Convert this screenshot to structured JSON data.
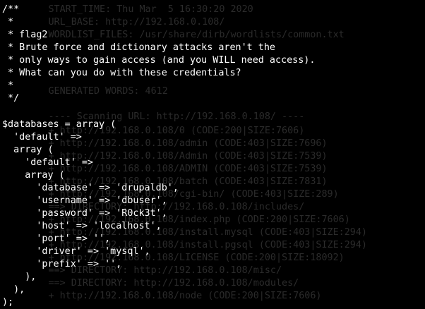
{
  "terminal": {
    "background_color": "#000000",
    "foreground_color": "#ffffff",
    "faded_color": "#2b2b2b",
    "background_lines": [
      "        START_TIME: Thu Mar  5 16:30:20 2020",
      "        URL_BASE: http://192.168.0.108/",
      "        WORDLIST_FILES: /usr/share/dirb/wordlists/common.txt",
      "",
      "",
      "",
      "",
      "        GENERATED WORDS: 4612",
      "",
      "        ---- Scanning URL: http://192.168.0.108/ ----",
      "        + http://192.168.0.108/0 (CODE:200|SIZE:7606)",
      "        + http://192.168.0.108/admin (CODE:403|SIZE:7696)",
      "        + http://192.168.0.108/Admin (CODE:403|SIZE:7539)",
      "        + http://192.168.0.108/ADMIN (CODE:403|SIZE:7539)",
      "        + http://192.168.0.108/batch (CODE:403|SIZE:7831)",
      "        + http://192.168.0.108/cgi-bin/ (CODE:403|SIZE:289)",
      "        ==> DIRECTORY: http://192.168.0.108/includes/",
      "        + http://192.168.0.108/index.php (CODE:200|SIZE:7606)",
      "        + http://192.168.0.108/install.mysql (CODE:403|SIZE:294)",
      "        + http://192.168.0.108/install.pgsql (CODE:403|SIZE:294)",
      "        + http://192.168.0.108/LICENSE (CODE:200|SIZE:18092)",
      "        ==> DIRECTORY: http://192.168.0.108/misc/",
      "        ==> DIRECTORY: http://192.168.0.108/modules/",
      "        + http://192.168.0.108/node (CODE:200|SIZE:7606)"
    ],
    "foreground_lines": [
      "/**",
      " *",
      " * flag2",
      " * Brute force and dictionary attacks aren't the",
      " * only ways to gain access (and you WILL need access).",
      " * What can you do with these credentials?",
      " *",
      " */",
      "",
      "$databases = array (",
      "  'default' =>",
      "  array (",
      "    'default' =>",
      "    array (",
      "      'database' => 'drupaldb',",
      "      'username' => 'dbuser',",
      "      'password' => 'R0ck3t',",
      "      'host' => 'localhost',",
      "      'port' => '',",
      "      'driver' => 'mysql',",
      "      'prefix' => '',",
      "    ),",
      "  ),",
      ");"
    ]
  }
}
